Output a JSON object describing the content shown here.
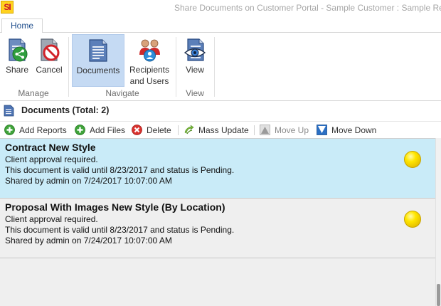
{
  "app": {
    "logo_text": "SI",
    "window_title": "Share Documents on Customer Portal - Sample Customer : Sample Resid"
  },
  "ribbon": {
    "tab_home": "Home",
    "buttons": {
      "share": "Share",
      "cancel": "Cancel",
      "documents": "Documents",
      "recipients_line1": "Recipients",
      "recipients_line2": "and Users",
      "view": "View"
    },
    "groups": {
      "manage": "Manage",
      "navigate": "Navigate",
      "view": "View"
    }
  },
  "documents_header": {
    "title": "Documents (Total: 2)"
  },
  "toolbar": {
    "add_reports": "Add Reports",
    "add_files": "Add Files",
    "delete": "Delete",
    "mass_update": "Mass Update",
    "move_up": "Move Up",
    "move_down": "Move Down"
  },
  "documents": [
    {
      "title": "Contract New Style",
      "line1": "Client approval required.",
      "line2": "This document is valid until 8/23/2017 and status is Pending.",
      "line3": "Shared by admin on 7/24/2017 10:07:00 AM",
      "selected": true
    },
    {
      "title": "Proposal With Images New Style (By Location)",
      "line1": "Client approval required.",
      "line2": "This document is valid until 8/23/2017 and status is Pending.",
      "line3": "Shared by admin on 7/24/2017 10:07:00 AM",
      "selected": false
    }
  ],
  "icons": {
    "share": "share-icon",
    "cancel": "cancel-icon",
    "documents": "documents-icon",
    "recipients": "recipients-users-icon",
    "view": "view-eye-icon",
    "add_reports": "add-icon",
    "add_files": "add-icon",
    "delete": "delete-icon",
    "mass_update": "mass-update-icon",
    "move_up": "move-up-icon",
    "move_down": "move-down-icon",
    "status": "pending-status-icon"
  },
  "colors": {
    "selected_row": "#c9ebf8",
    "active_ribbon_button": "#c5daf3",
    "status_indicator": "#ffe600"
  }
}
